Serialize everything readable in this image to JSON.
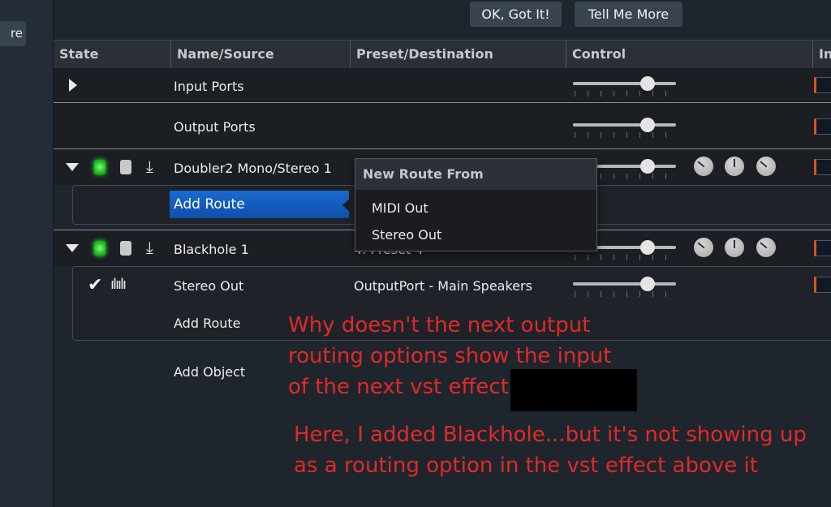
{
  "left_panel": {
    "button_label": "re"
  },
  "top_bar": {
    "ok_label": "OK, Got It!",
    "more_label": "Tell Me More"
  },
  "columns": [
    "State",
    "Name/Source",
    "Preset/Destination",
    "Control",
    "In"
  ],
  "rows": {
    "input_ports": "Input Ports",
    "output_ports": "Output Ports",
    "doubler_name": "Doubler2 Mono/Stereo 1",
    "doubler_add_route": "Add Route",
    "blackhole_name": "Blackhole 1",
    "blackhole_preset": "4. Preset 4",
    "stereo_out_name": "Stereo Out",
    "stereo_out_destination": "OutputPort - Main Speakers",
    "blackhole_add_route": "Add Route",
    "add_object": "Add Object"
  },
  "popup": {
    "title": "New Route From",
    "items": [
      "MIDI Out",
      "Stereo Out"
    ]
  },
  "annotations": {
    "line1": "Why doesn't the next output",
    "line2": "routing options show the input",
    "line3": "of the next vst effect -",
    "line4": "Here, I added Blackhole...but it's not showing up",
    "line5": "as a routing option in the vst effect above it"
  },
  "colors": {
    "accent_blue": "#1a6ad0",
    "annotation_red": "#e02a2a",
    "led_green": "#2dff2d",
    "meter_orange": "#d9541a"
  }
}
